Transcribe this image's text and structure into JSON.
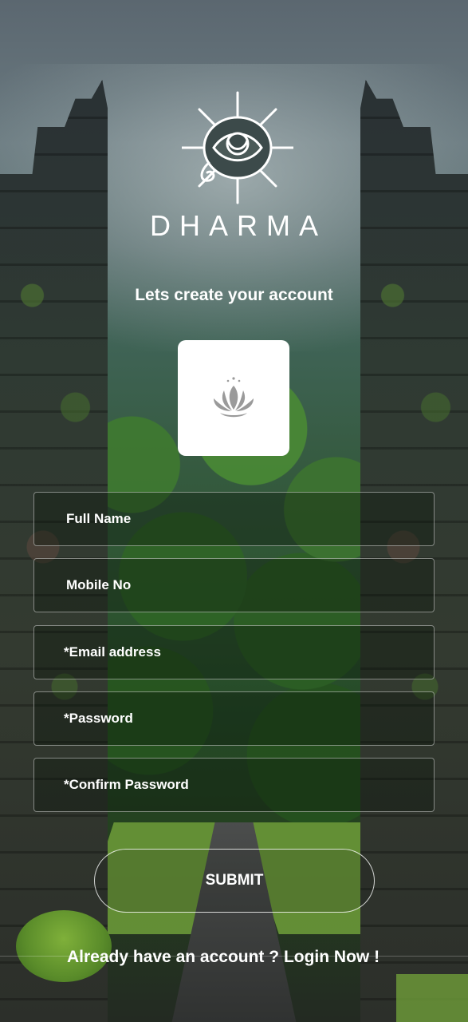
{
  "brand": {
    "name": "DHARMA",
    "logo_icon": "eye-sun-icon"
  },
  "header": {
    "headline": "Lets create your account"
  },
  "avatar": {
    "icon": "lotus-icon",
    "icon_color": "#9a9a9a"
  },
  "form": {
    "fields": [
      {
        "placeholder": "Full Name",
        "value": ""
      },
      {
        "placeholder": "Mobile No",
        "value": ""
      },
      {
        "placeholder": "*Email address",
        "value": ""
      },
      {
        "placeholder": "*Password",
        "value": ""
      },
      {
        "placeholder": "*Confirm Password",
        "value": ""
      }
    ],
    "submit_label": "SUBMIT"
  },
  "footer": {
    "prompt": "Already have an account ? ",
    "login_link": "Login Now !"
  },
  "colors": {
    "text": "#ffffff",
    "card": "#ffffff"
  }
}
